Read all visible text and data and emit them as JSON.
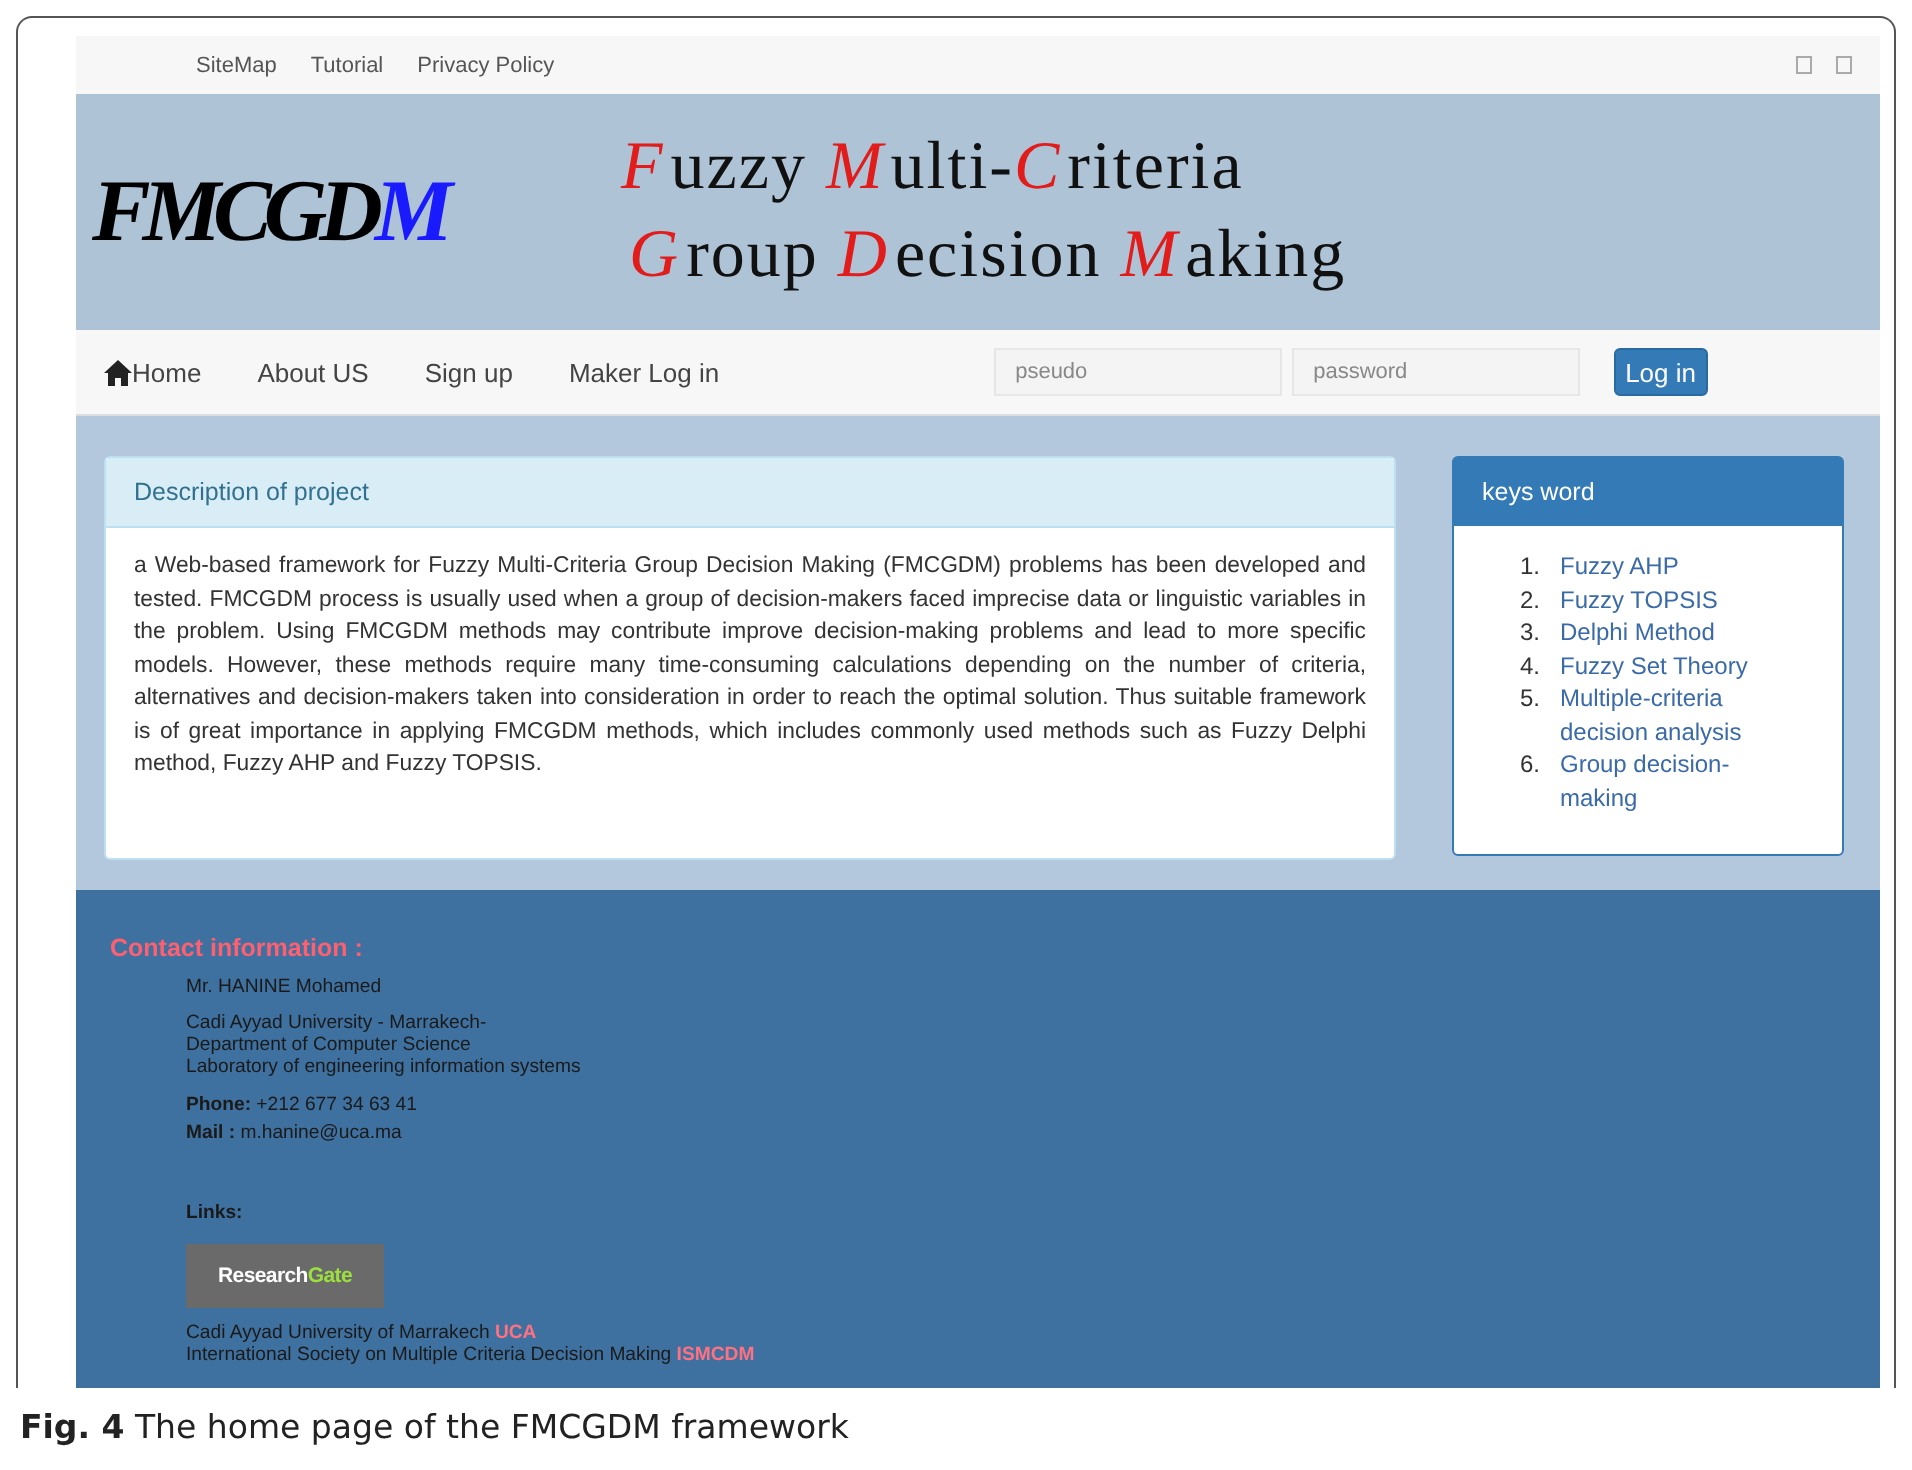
{
  "top_links": [
    "SiteMap",
    "Tutorial",
    "Privacy Policy"
  ],
  "logo": {
    "parts": [
      {
        "text": "FMCGD",
        "accent": false
      },
      {
        "text": "M",
        "accent": true
      }
    ]
  },
  "banner_lines": [
    {
      "parts": [
        {
          "text": "F",
          "accent": true
        },
        {
          "text": "uzzy ",
          "accent": false
        },
        {
          "text": "M",
          "accent": true
        },
        {
          "text": "ulti-",
          "accent": false
        },
        {
          "text": "C",
          "accent": true
        },
        {
          "text": "riteria",
          "accent": false
        }
      ]
    },
    {
      "parts": [
        {
          "text": "G",
          "accent": true
        },
        {
          "text": "roup ",
          "accent": false
        },
        {
          "text": "D",
          "accent": true
        },
        {
          "text": "ecision ",
          "accent": false
        },
        {
          "text": "M",
          "accent": true
        },
        {
          "text": "aking",
          "accent": false
        }
      ]
    }
  ],
  "nav": {
    "items": [
      {
        "label": "Home"
      },
      {
        "label": "About US"
      },
      {
        "label": "Sign up"
      },
      {
        "label": "Maker Log in"
      }
    ],
    "login": {
      "fields": [
        {
          "placeholder": "pseudo"
        },
        {
          "placeholder": "password"
        }
      ],
      "button": "Log in"
    }
  },
  "description": {
    "title": "Description of project",
    "text": "a Web-based framework for Fuzzy Multi-Criteria Group Decision Making (FMCGDM) problems has been developed and tested. FMCGDM process is usually used when a group of decision-makers faced imprecise data or linguistic variables in the problem. Using FMCGDM methods may contribute improve decision-making problems and lead to more specific models. However, these methods require many time-consuming calculations depending on the number of criteria, alternatives and decision-makers taken into consideration in order to reach the optimal solution. Thus suitable framework is of great importance in applying FMCGDM methods, which includes commonly used methods such as Fuzzy Delphi method, Fuzzy AHP and Fuzzy TOPSIS."
  },
  "keywords": {
    "title": "keys word",
    "items": [
      {
        "number": "1.",
        "label": "Fuzzy AHP"
      },
      {
        "number": "2.",
        "label": "Fuzzy TOPSIS"
      },
      {
        "number": "3.",
        "label": "Delphi Method"
      },
      {
        "number": "4.",
        "label": "Fuzzy Set Theory"
      },
      {
        "number": "5.",
        "label": "Multiple-criteria decision analysis"
      },
      {
        "number": "6.",
        "label": "Group decision-making"
      }
    ]
  },
  "footer": {
    "heading": "Contact information :",
    "name": "Mr. HANINE Mohamed",
    "address": [
      "Cadi Ayyad University - Marrakech-",
      "Department of Computer Science",
      "Laboratory of engineering information systems"
    ],
    "contacts": [
      "**Phone:** +212 677 34 63 41",
      "**Mail :** m.hanine@uca.ma"
    ],
    "links_label": "Links:",
    "badge": {
      "parts": [
        {
          "text": "Research",
          "accent": false
        },
        {
          "text": "Gate",
          "accent": true
        }
      ]
    },
    "link_lines": [
      {
        "text": "Cadi Ayyad University of Marrakech",
        "link": "UCA"
      },
      {
        "text": "International Society on Multiple Criteria Decision Making",
        "link": "ISMCDM"
      }
    ]
  },
  "caption": "**Fig. 4**  The home page of the FMCGDM framework"
}
